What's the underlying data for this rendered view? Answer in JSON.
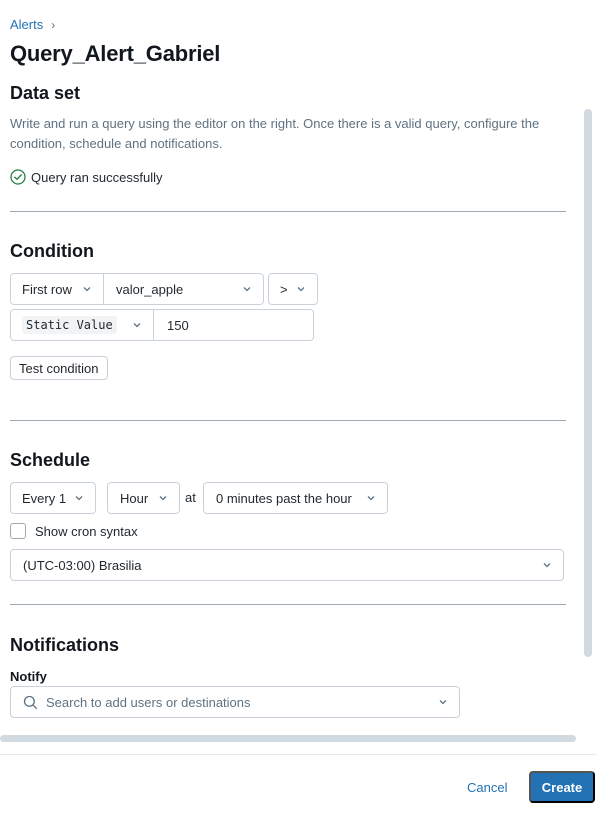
{
  "breadcrumb": {
    "parent": "Alerts",
    "separator": "›"
  },
  "page": {
    "title": "Query_Alert_Gabriel"
  },
  "dataset": {
    "title": "Data set",
    "description": "Write and run a query using the editor on the right. Once there is a valid query, configure the condition, schedule and notifications.",
    "status": "Query ran successfully"
  },
  "condition": {
    "title": "Condition",
    "row_select": "First row",
    "column_select": "valor_apple",
    "operator_select": ">",
    "value_type_select": "Static Value",
    "threshold_value": "150",
    "test_button": "Test condition"
  },
  "schedule": {
    "title": "Schedule",
    "interval_select": "Every 1",
    "unit_select": "Hour",
    "at_label": "at",
    "minutes_select": "0 minutes past the hour",
    "cron_label": "Show cron syntax",
    "cron_checked": false,
    "timezone_select": "(UTC-03:00) Brasilia"
  },
  "notifications": {
    "title": "Notifications",
    "notify_label": "Notify",
    "search_placeholder": "Search to add users or destinations"
  },
  "footer": {
    "cancel": "Cancel",
    "create": "Create"
  },
  "colors": {
    "accent": "#2272b4",
    "success": "#277c43",
    "border": "#c9d2da",
    "muted_text": "#5f7281"
  },
  "icons": [
    "chevron-right-icon",
    "check-circle-icon",
    "chevron-down-icon",
    "search-icon"
  ]
}
